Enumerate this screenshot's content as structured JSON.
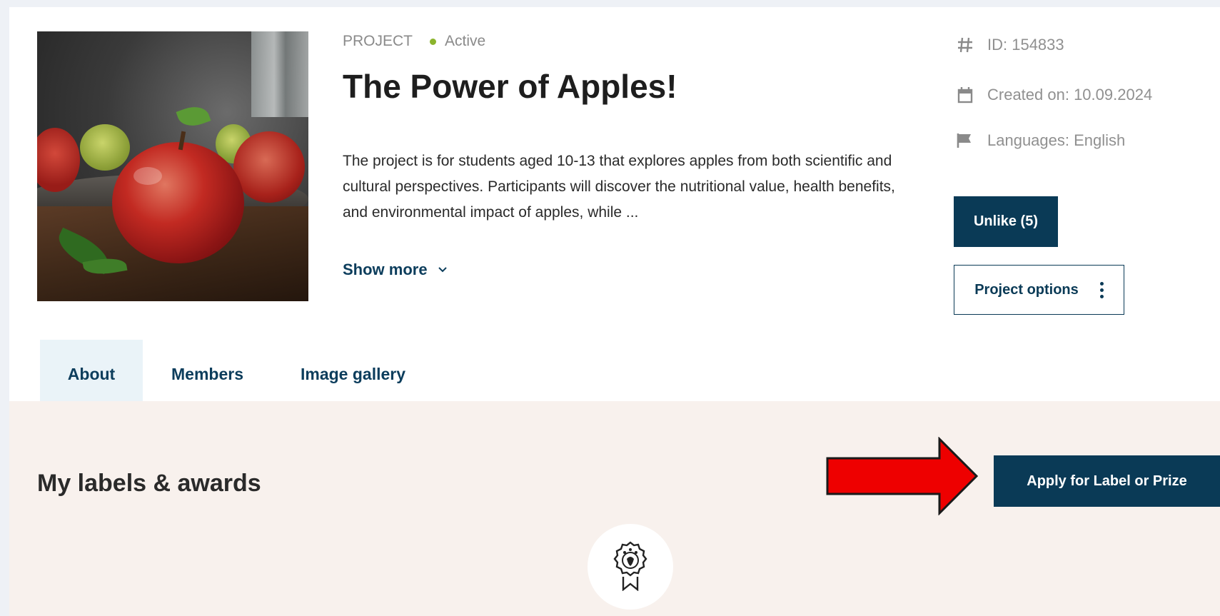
{
  "project": {
    "type_label": "PROJECT",
    "status": "Active",
    "status_color": "#8bb42d",
    "title": "The Power of Apples!",
    "description": "The project is for students aged 10-13 that explores apples from both scientific and cultural perspectives. Participants will discover the nutritional value, health benefits, and environmental impact of apples, while ...",
    "show_more": "Show more",
    "image_alt": "Red apples on a wooden table"
  },
  "info": {
    "id": "ID: 154833",
    "created": "Created on: 10.09.2024",
    "languages": "Languages: English"
  },
  "actions": {
    "unlike": "Unlike (5)",
    "options": "Project options",
    "accent": "#0a3a56"
  },
  "tabs": [
    {
      "label": "About",
      "active": true
    },
    {
      "label": "Members",
      "active": false
    },
    {
      "label": "Image gallery",
      "active": false
    }
  ],
  "awards": {
    "title": "My labels & awards",
    "apply_button": "Apply for Label or Prize",
    "arrow_color": "#ee0000"
  },
  "icons": [
    "hash-icon",
    "calendar-icon",
    "flag-icon",
    "chevron-down-icon",
    "kebab-icon",
    "award-icon"
  ]
}
